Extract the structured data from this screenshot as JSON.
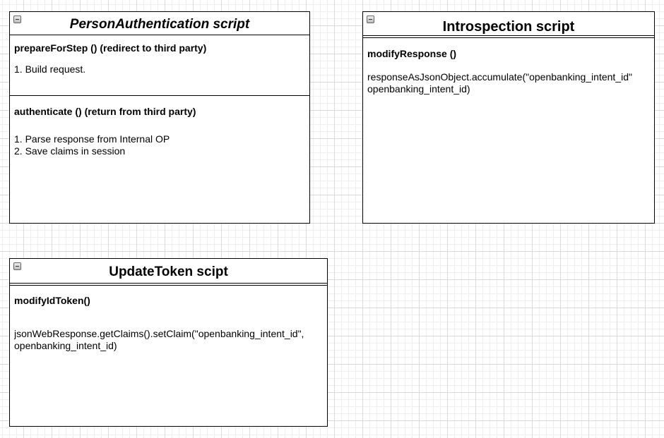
{
  "person_auth": {
    "title": "PersonAuthentication script",
    "method1": "prepareForStep () (redirect to third party)",
    "method1_steps": [
      "1. Build request."
    ],
    "method2": "authenticate () (return from third party)",
    "method2_steps": [
      "1. Parse response from Internal OP",
      "2. Save claims in session"
    ]
  },
  "introspection": {
    "title": "Introspection script",
    "method": "modifyResponse ()",
    "code_lines": [
      "responseAsJsonObject.accumulate(\"openbanking_intent_id\"",
      "openbanking_intent_id)"
    ]
  },
  "update_token": {
    "title": "UpdateToken scipt",
    "method": "modifyIdToken()",
    "code_lines": [
      "jsonWebResponse.getClaims().setClaim(\"openbanking_intent_id\",",
      "openbanking_intent_id)"
    ]
  }
}
